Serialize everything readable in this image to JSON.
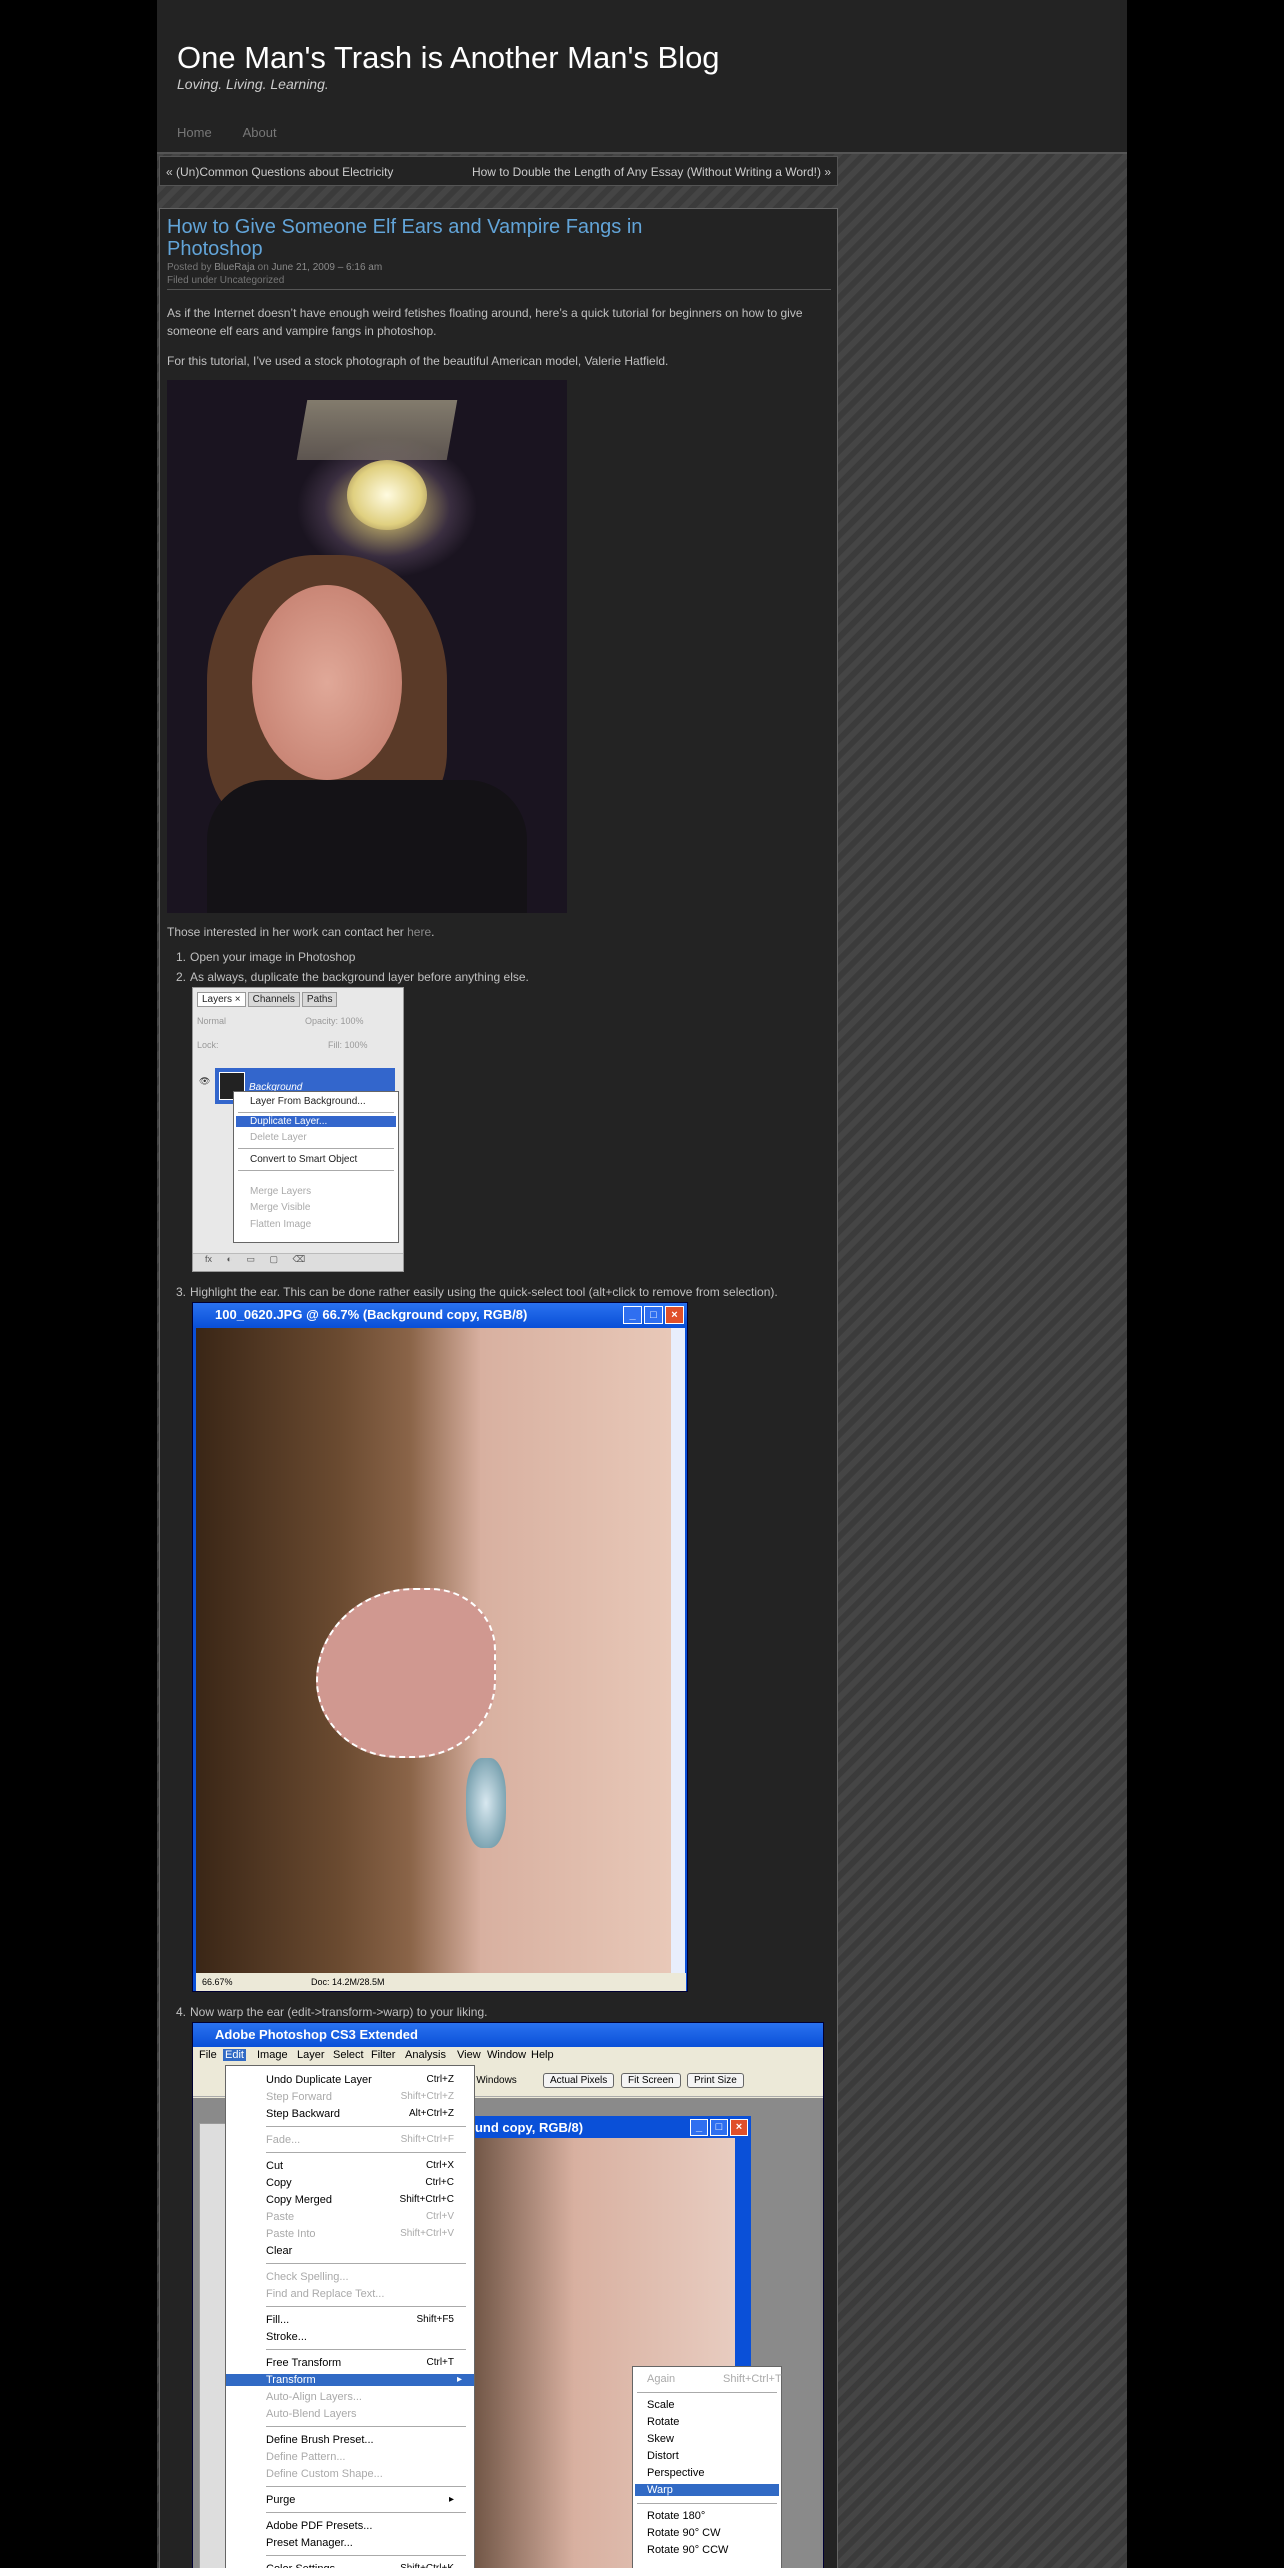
{
  "blog": {
    "title": "One Man's Trash is Another Man's Blog",
    "tagline": "Loving. Living. Learning.",
    "nav": [
      "Home",
      "About"
    ]
  },
  "post_nav": {
    "prev": "« (Un)Common Questions about Electricity",
    "next": "How to Double the Length of Any Essay (Without Writing a Word!) »"
  },
  "post": {
    "title": "How to Give Someone Elf Ears and Vampire Fangs in Photoshop",
    "posted_by_prefix": "Posted by ",
    "author": "BlueRaja",
    "on": " on ",
    "date": "June 21, 2009 – 6:16 am",
    "filed": "Filed under Uncategorized",
    "intro": "As if the Internet doesn’t have enough weird fetishes floating around, here’s a quick tutorial for beginners on how to give someone elf ears and vampire fangs in photoshop.",
    "stock": "For this tutorial, I’ve used a stock photograph of the beautiful American model, Valerie Hatfield.",
    "contact_prefix": "Those interested in her work can contact her ",
    "contact_link": "here",
    "contact_suffix": ".",
    "steps": [
      "Open your image in Photoshop",
      "As always, duplicate the background layer before anything else.",
      "Highlight the ear. This can be done rather easily using the quick-select tool (alt+click to remove from selection).",
      "Now warp the ear (edit->transform->warp) to your liking."
    ],
    "step_nums": [
      "1.",
      "2.",
      "3.",
      "4."
    ]
  },
  "layers_panel": {
    "tabs": [
      "Layers ×",
      "Channels",
      "Paths"
    ],
    "mode": "Normal",
    "opacity": "Opacity: 100%",
    "lock": "Lock:",
    "fill": "Fill: 100%",
    "layer_name": "Background",
    "menu": [
      {
        "label": "Layer From Background...",
        "state": "normal"
      },
      {
        "label": "Duplicate Layer...",
        "state": "selected"
      },
      {
        "label": "Delete Layer",
        "state": "disabled"
      },
      {
        "label": "Convert to Smart Object",
        "state": "normal"
      },
      {
        "label": "Merge Layers",
        "state": "disabled"
      },
      {
        "label": "Merge Visible",
        "state": "disabled"
      },
      {
        "label": "Flatten Image",
        "state": "disabled"
      }
    ],
    "footer": [
      "fx",
      "◐",
      "▭",
      "▢",
      "⌫"
    ]
  },
  "ear_window": {
    "title": "100_0620.JPG @ 66.7% (Background copy, RGB/8)",
    "zoom": "66.67%",
    "doc": "Doc: 14.2M/28.5M"
  },
  "photoshop": {
    "app_title": "Adobe Photoshop CS3 Extended",
    "menus": [
      "File",
      "Edit",
      "Image",
      "Layer",
      "Select",
      "Filter",
      "Analysis",
      "View",
      "Window",
      "Help"
    ],
    "options": [
      "ll Windows",
      "Actual Pixels",
      "Fit Screen",
      "Print Size"
    ],
    "doc_title": "ound copy, RGB/8)",
    "edit_menu": [
      {
        "label": "Undo Duplicate Layer",
        "key": "Ctrl+Z",
        "state": "normal"
      },
      {
        "label": "Step Forward",
        "key": "Shift+Ctrl+Z",
        "state": "disabled"
      },
      {
        "label": "Step Backward",
        "key": "Alt+Ctrl+Z",
        "state": "normal"
      },
      {
        "label": "Fade...",
        "key": "Shift+Ctrl+F",
        "state": "disabled"
      },
      {
        "label": "Cut",
        "key": "Ctrl+X",
        "state": "normal"
      },
      {
        "label": "Copy",
        "key": "Ctrl+C",
        "state": "normal"
      },
      {
        "label": "Copy Merged",
        "key": "Shift+Ctrl+C",
        "state": "normal"
      },
      {
        "label": "Paste",
        "key": "Ctrl+V",
        "state": "disabled"
      },
      {
        "label": "Paste Into",
        "key": "Shift+Ctrl+V",
        "state": "disabled"
      },
      {
        "label": "Clear",
        "key": "",
        "state": "normal"
      },
      {
        "label": "Check Spelling...",
        "key": "",
        "state": "disabled"
      },
      {
        "label": "Find and Replace Text...",
        "key": "",
        "state": "disabled"
      },
      {
        "label": "Fill...",
        "key": "Shift+F5",
        "state": "normal"
      },
      {
        "label": "Stroke...",
        "key": "",
        "state": "normal"
      },
      {
        "label": "Free Transform",
        "key": "Ctrl+T",
        "state": "normal"
      },
      {
        "label": "Transform",
        "key": "▸",
        "state": "selected"
      },
      {
        "label": "Auto-Align Layers...",
        "key": "",
        "state": "disabled"
      },
      {
        "label": "Auto-Blend Layers",
        "key": "",
        "state": "disabled"
      },
      {
        "label": "Define Brush Preset...",
        "key": "",
        "state": "normal"
      },
      {
        "label": "Define Pattern...",
        "key": "",
        "state": "disabled"
      },
      {
        "label": "Define Custom Shape...",
        "key": "",
        "state": "disabled"
      },
      {
        "label": "Purge",
        "key": "▸",
        "state": "normal"
      },
      {
        "label": "Adobe PDF Presets...",
        "key": "",
        "state": "normal"
      },
      {
        "label": "Preset Manager...",
        "key": "",
        "state": "normal"
      },
      {
        "label": "Color Settings...",
        "key": "Shift+Ctrl+K",
        "state": "normal"
      }
    ],
    "transform_menu": [
      {
        "label": "Again",
        "key": "Shift+Ctrl+T",
        "state": "disabled"
      },
      {
        "label": "Scale",
        "state": "normal"
      },
      {
        "label": "Rotate",
        "state": "normal"
      },
      {
        "label": "Skew",
        "state": "normal"
      },
      {
        "label": "Distort",
        "state": "normal"
      },
      {
        "label": "Perspective",
        "state": "normal"
      },
      {
        "label": "Warp",
        "state": "selected"
      },
      {
        "label": "Rotate 180°",
        "state": "normal"
      },
      {
        "label": "Rotate 90° CW",
        "state": "normal"
      },
      {
        "label": "Rotate 90° CCW",
        "state": "normal"
      }
    ]
  },
  "colors": {
    "link_blue": "#62a4d8",
    "selection": "#316ac5",
    "xp_blue": "#0a50d8"
  }
}
